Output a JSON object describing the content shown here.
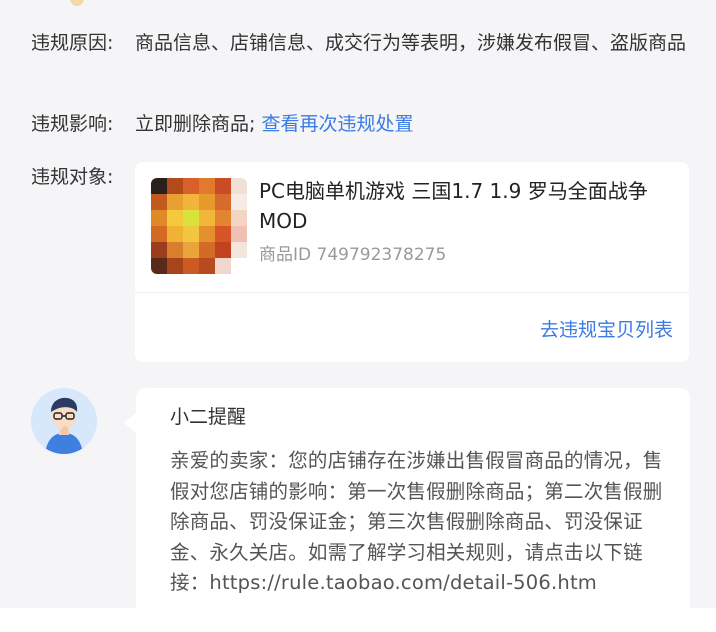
{
  "violation": {
    "reason_label": "违规原因:",
    "reason_text": "商品信息、店铺信息、成交行为等表明，涉嫌发布假冒、盗版商品",
    "impact_label": "违规影响:",
    "impact_text": "立即删除商品;",
    "impact_link": "查看再次违规处置",
    "target_label": "违规对象:"
  },
  "product": {
    "title": "PC电脑单机游戏 三国1.7 1.9 罗马全面战争MOD",
    "id_label": "商品ID",
    "id_value": "749792378275",
    "list_link": "去违规宝贝列表"
  },
  "reminder": {
    "title": "小二提醒",
    "body": "亲爱的卖家：您的店铺存在涉嫌出售假冒商品的情况，售假对您店铺的影响：第一次售假删除商品；第二次售假删除商品、罚没保证金；第三次售假删除商品、罚没保证金、永久关店。如需了解学习相关规则，请点击以下链接：https://rule.taobao.com/detail-506.htm"
  },
  "colors": {
    "page_bg": "#f5f5f7",
    "card_bg": "#ffffff",
    "link": "#3b7be5",
    "muted": "#999999",
    "text": "#333333"
  }
}
